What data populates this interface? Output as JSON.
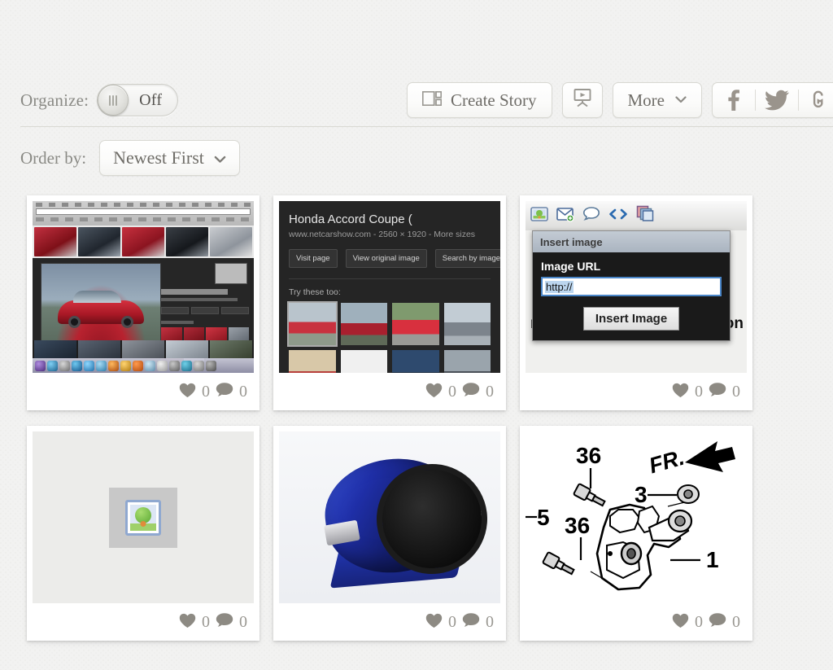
{
  "toolbar": {
    "organize_label": "Organize:",
    "toggle_state": "Off",
    "create_story_label": "Create Story",
    "create_story_icon": "collage-layout-icon",
    "slideshow_icon": "presentation-screen-icon",
    "more_label": "More",
    "more_caret": "⌄",
    "social": [
      {
        "name": "facebook",
        "glyph": "f"
      },
      {
        "name": "twitter",
        "glyph": "\u0001"
      },
      {
        "name": "third-network",
        "glyph": "\u0001"
      }
    ]
  },
  "orderby": {
    "label": "Order by:",
    "value": "Newest First",
    "caret": "⌄"
  },
  "cards": [
    {
      "name": "google-image-search-screenshot",
      "likes": "0",
      "comments": "0"
    },
    {
      "name": "google-image-detail-panel",
      "likes": "0",
      "comments": "0",
      "detail": {
        "title": "Honda Accord Coupe (",
        "subtitle": "www.netcarshow.com - 2560 × 1920 - More sizes",
        "buttons": [
          "Visit page",
          "View original image",
          "Search by image"
        ],
        "try_these": "Try these too:"
      }
    },
    {
      "name": "insert-image-dialog-screenshot",
      "likes": "0",
      "comments": "0",
      "dialog": {
        "title": "Insert image",
        "field_label": "Image URL",
        "field_value": "http://",
        "submit_label": "Insert Image",
        "toolbar_icons": [
          "image-icon",
          "email-icon",
          "comment-icon",
          "code-icon",
          "copy-icon"
        ],
        "bg_text_left": "re",
        "bg_text_right": "on"
      }
    },
    {
      "name": "missing-image-placeholder",
      "likes": "0",
      "comments": "0"
    },
    {
      "name": "blue-fuel-pump-bracket",
      "likes": "0",
      "comments": "0"
    },
    {
      "name": "parts-diagram",
      "likes": "0",
      "comments": "0",
      "diagram": {
        "labels": [
          "36",
          "5",
          "36",
          "3",
          "1"
        ],
        "direction_marker": "FR."
      }
    }
  ],
  "icons": {
    "heart": "♥",
    "comment": "•"
  },
  "colors": {
    "page_bg": "#f2f2f1",
    "card_bg": "#ffffff",
    "text_muted": "#8a8a85",
    "text_dark": "#6f6d68",
    "border": "#d8d8d2"
  }
}
